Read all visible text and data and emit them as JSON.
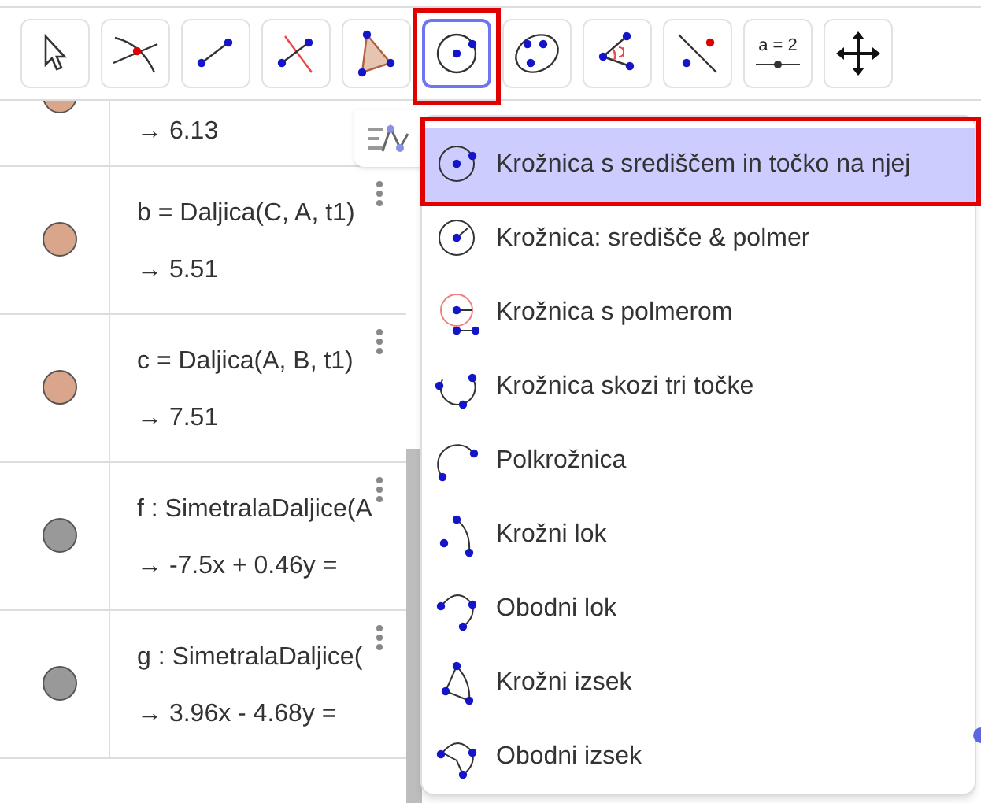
{
  "toolbar": {
    "tools": [
      {
        "kind": "move",
        "selected": false
      },
      {
        "kind": "intersect",
        "selected": false
      },
      {
        "kind": "segment",
        "selected": false
      },
      {
        "kind": "perpendicular",
        "selected": false
      },
      {
        "kind": "polygon",
        "selected": false
      },
      {
        "kind": "circle",
        "selected": true
      },
      {
        "kind": "ellipse",
        "selected": false
      },
      {
        "kind": "angle",
        "selected": false
      },
      {
        "kind": "reflect",
        "selected": false
      },
      {
        "kind": "slider",
        "selected": false,
        "label": "a = 2"
      },
      {
        "kind": "pan",
        "selected": false
      }
    ]
  },
  "algebra": {
    "rows": [
      {
        "color": "#d9a68c",
        "value": "→  6.13"
      },
      {
        "color": "#d9a68c",
        "definition": "b = Daljica(C, A, t1)",
        "value": "→  5.51"
      },
      {
        "color": "#d9a68c",
        "definition": "c = Daljica(A, B, t1)",
        "value": "→  7.51"
      },
      {
        "color": "#999999",
        "definition": "f : SimetralaDaljice(A",
        "value": "→  -7.5x + 0.46y ="
      },
      {
        "color": "#999999",
        "definition": "g : SimetralaDaljice(",
        "value": "→  3.96x - 4.68y ="
      }
    ]
  },
  "tool_menu": {
    "items": [
      {
        "kind": "center-point",
        "label": "Krožnica s središčem in točko na njej",
        "selected": true
      },
      {
        "kind": "center-radius",
        "label": "Krožnica: središče & polmer",
        "selected": false
      },
      {
        "kind": "compass",
        "label": "Krožnica s polmerom",
        "selected": false
      },
      {
        "kind": "three-points",
        "label": "Krožnica skozi tri točke",
        "selected": false
      },
      {
        "kind": "semicircle",
        "label": "Polkrožnica",
        "selected": false
      },
      {
        "kind": "arc",
        "label": "Krožni lok",
        "selected": false
      },
      {
        "kind": "circum-arc",
        "label": "Obodni lok",
        "selected": false
      },
      {
        "kind": "sector",
        "label": "Krožni izsek",
        "selected": false
      },
      {
        "kind": "circum-sector",
        "label": "Obodni izsek",
        "selected": false
      }
    ]
  }
}
